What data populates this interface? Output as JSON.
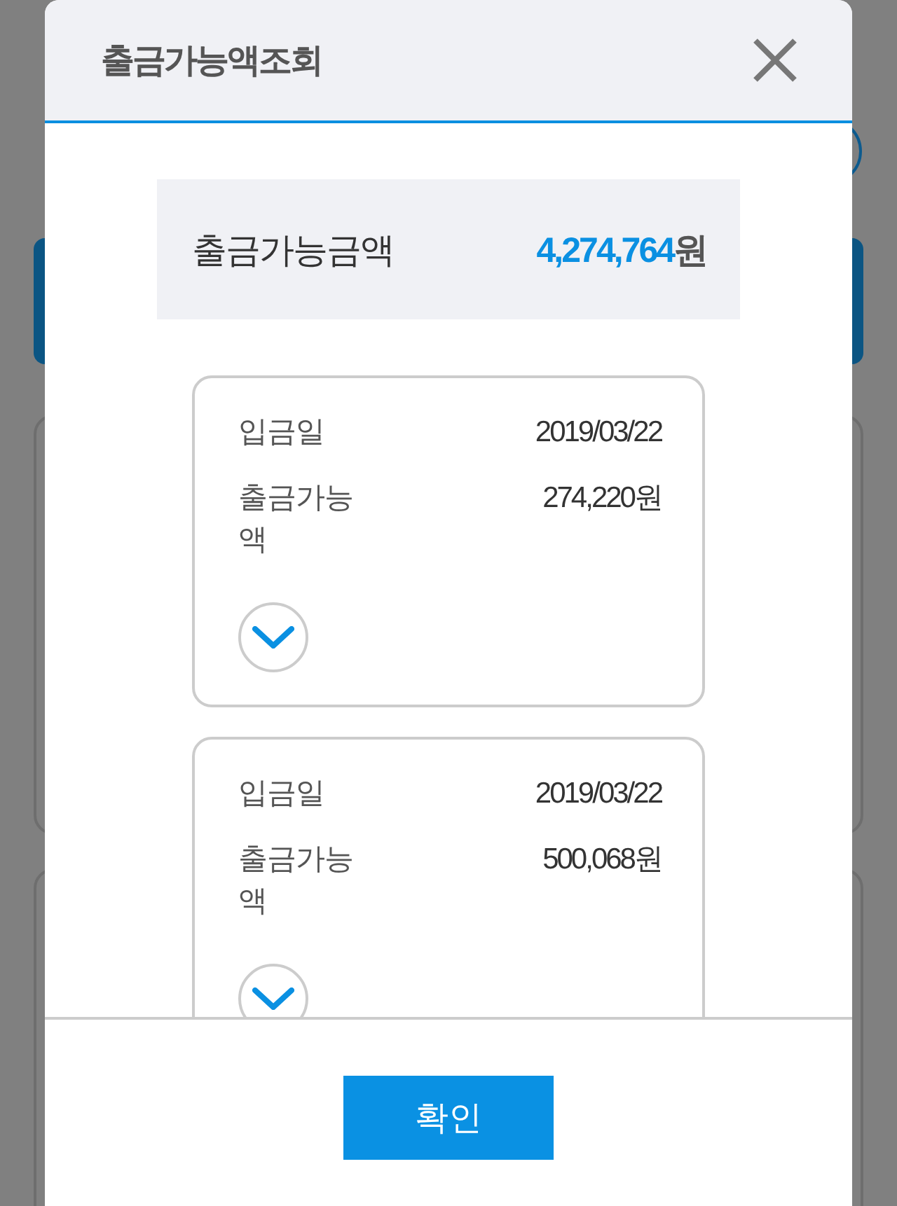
{
  "dialog": {
    "title": "출금가능액조회"
  },
  "summary": {
    "label": "출금가능금액",
    "amount": "4,274,764",
    "unit": "원"
  },
  "deposits": [
    {
      "expanded": false,
      "fields": [
        {
          "label": "입금일",
          "value": "2019/03/22"
        },
        {
          "label": "출금가능액",
          "value": "274,220원"
        }
      ]
    },
    {
      "expanded": false,
      "fields": [
        {
          "label": "입금일",
          "value": "2019/03/22"
        },
        {
          "label": "출금가능액",
          "value": "500,068원"
        }
      ]
    }
  ],
  "footer": {
    "button": "확인"
  }
}
